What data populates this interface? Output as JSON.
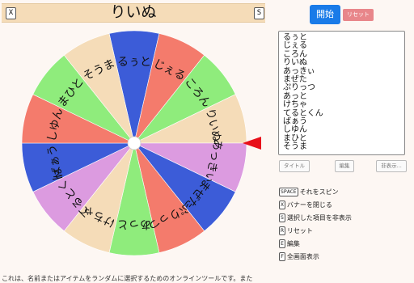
{
  "banner": {
    "title": "りいぬ",
    "close_key": "X",
    "s_key": "S"
  },
  "wheel": {
    "segments": [
      {
        "label": "るぅと",
        "color": "#3c5cd8"
      },
      {
        "label": "じぇる",
        "color": "#f47b6c"
      },
      {
        "label": "ころん",
        "color": "#8fec7c"
      },
      {
        "label": "りいぬ",
        "color": "#f5dcb8"
      },
      {
        "label": "あっきぃ",
        "color": "#dc9be0"
      },
      {
        "label": "まぜた",
        "color": "#3c5cd8"
      },
      {
        "label": "ぷりっつ",
        "color": "#f47b6c"
      },
      {
        "label": "あっと",
        "color": "#8fec7c"
      },
      {
        "label": "けちゃ",
        "color": "#f5dcb8"
      },
      {
        "label": "てるとくん",
        "color": "#dc9be0"
      },
      {
        "label": "ばぁう",
        "color": "#3c5cd8"
      },
      {
        "label": "しゆん",
        "color": "#f47b6c"
      },
      {
        "label": "まひと",
        "color": "#8fec7c"
      },
      {
        "label": "そうま",
        "color": "#f5dcb8"
      }
    ],
    "pointer_color": "#e8101a",
    "hub_color": "#ffffff"
  },
  "controls": {
    "start_label": "開始",
    "reset_label": "リセット"
  },
  "item_list": [
    "るぅと",
    "じぇる",
    "ころん",
    "りいぬ",
    "あっきぃ",
    "まぜた",
    "ぷりっつ",
    "あっと",
    "けちゃ",
    "てるとくん",
    "ばぁう",
    "しゆん",
    "まひと",
    "そうま"
  ],
  "buttons": {
    "title": "タイトル",
    "edit": "編集",
    "hide": "非表示..."
  },
  "shortcuts": [
    {
      "key": "SPACE",
      "label": "それをスピン"
    },
    {
      "key": "X",
      "label": "バナーを閉じる"
    },
    {
      "key": "S",
      "label": "選択した項目を非表示"
    },
    {
      "key": "R",
      "label": "リセット"
    },
    {
      "key": "E",
      "label": "編集"
    },
    {
      "key": "F",
      "label": "全画面表示"
    }
  ],
  "footer_text": "これは、名前またはアイテムをランダムに選択するためのオンラインツールです。また"
}
